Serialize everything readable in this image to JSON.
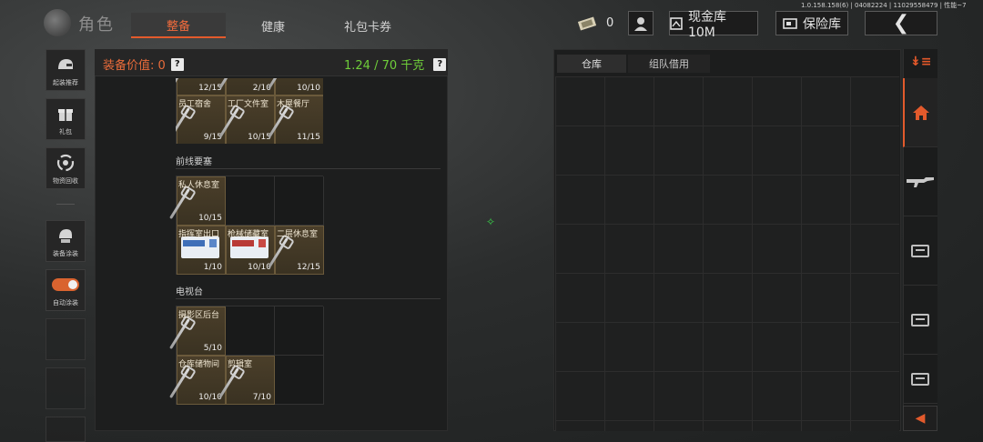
{
  "version_text": "1.0.158.158(6) | 04082224 | 11029558479 | 性能~7",
  "header": {
    "title": "角色",
    "tabs": [
      "整备",
      "健康",
      "礼包卡券"
    ],
    "active_tab": 0,
    "currency_count": "0",
    "cash_label": "现金库 10M",
    "vault_label": "保险库"
  },
  "sidebar": {
    "buttons": [
      {
        "label": "起装推荐",
        "icon": "helmet-icon"
      },
      {
        "label": "礼包",
        "icon": "gift-icon"
      },
      {
        "label": "物资回收",
        "icon": "recycle-icon"
      },
      {
        "label": "装备涂装",
        "icon": "paint-helmet-icon"
      },
      {
        "label": "自动涂装",
        "icon": "toggle-icon"
      }
    ]
  },
  "equipment": {
    "value_label": "装备价值: 0",
    "weight_label": "1.24 / 70 千克",
    "sections": [
      {
        "title": "",
        "items": [
          {
            "name": "",
            "count": "12/15",
            "kind": "key"
          },
          {
            "name": "",
            "count": "2/10",
            "kind": "key"
          },
          {
            "name": "",
            "count": "10/10",
            "kind": "key"
          },
          {
            "name": "员工宿舍",
            "count": "9/15",
            "kind": "key"
          },
          {
            "name": "工厂文件室",
            "count": "10/15",
            "kind": "key"
          },
          {
            "name": "木屋餐厅",
            "count": "11/15",
            "kind": "key"
          }
        ]
      },
      {
        "title": "前线要塞",
        "items": [
          {
            "name": "私人休息室",
            "count": "10/15",
            "kind": "key"
          },
          {
            "name": "",
            "count": "",
            "kind": "empty"
          },
          {
            "name": "",
            "count": "",
            "kind": "empty"
          },
          {
            "name": "指挥室出口",
            "count": "1/10",
            "kind": "card"
          },
          {
            "name": "枪械储藏室",
            "count": "10/10",
            "kind": "card-red"
          },
          {
            "name": "二层休息室",
            "count": "12/15",
            "kind": "key"
          }
        ]
      },
      {
        "title": "电视台",
        "items": [
          {
            "name": "摄影区后台",
            "count": "5/10",
            "kind": "key"
          },
          {
            "name": "",
            "count": "",
            "kind": "empty"
          },
          {
            "name": "",
            "count": "",
            "kind": "empty"
          },
          {
            "name": "仓库储物间",
            "count": "10/10",
            "kind": "key"
          },
          {
            "name": "剪辑室",
            "count": "7/10",
            "kind": "key"
          },
          {
            "name": "",
            "count": "",
            "kind": "empty"
          }
        ]
      }
    ]
  },
  "warehouse": {
    "tabs": [
      "仓库",
      "组队借用"
    ],
    "active_tab": 0
  },
  "colors": {
    "accent": "#e35a2c",
    "weight_green": "#6fce3a",
    "item_bg": "#4b3f2a"
  }
}
